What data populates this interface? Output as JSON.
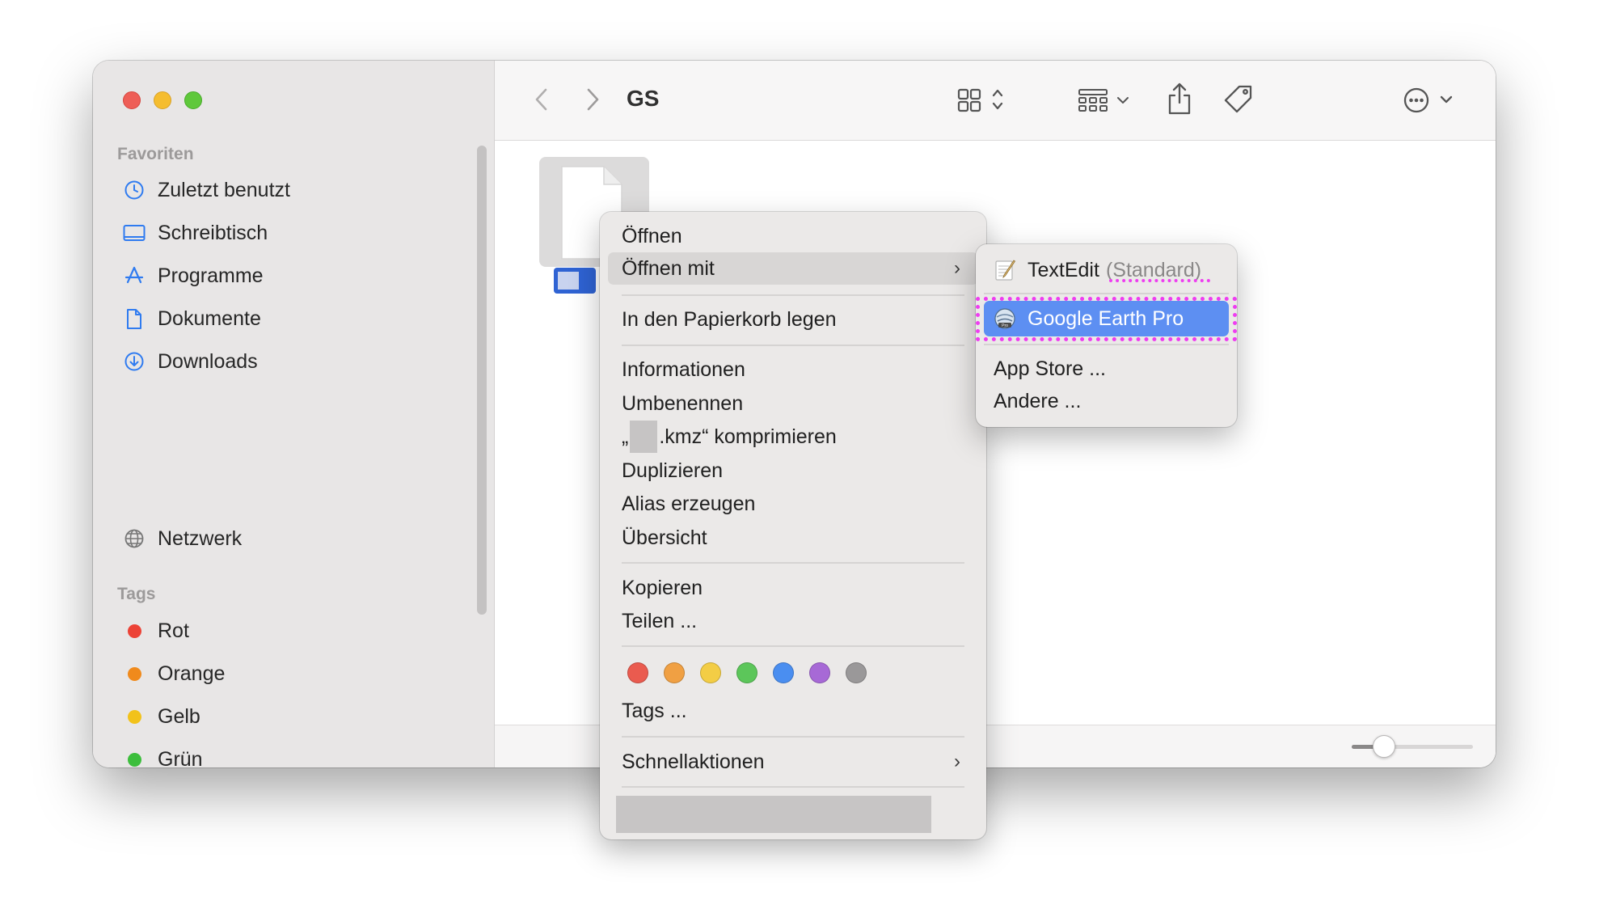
{
  "window": {
    "title": "GS"
  },
  "sidebar": {
    "favorites_heading": "Favoriten",
    "favorites": [
      {
        "label": "Zuletzt benutzt",
        "icon": "clock-icon"
      },
      {
        "label": "Schreibtisch",
        "icon": "desktop-icon"
      },
      {
        "label": "Programme",
        "icon": "apps-icon"
      },
      {
        "label": "Dokumente",
        "icon": "document-icon"
      },
      {
        "label": "Downloads",
        "icon": "download-icon"
      }
    ],
    "network": {
      "label": "Netzwerk",
      "icon": "globe-icon"
    },
    "tags_heading": "Tags",
    "tags": [
      {
        "label": "Rot",
        "color": "#ec4236"
      },
      {
        "label": "Orange",
        "color": "#f08a1c"
      },
      {
        "label": "Gelb",
        "color": "#f2c21a"
      },
      {
        "label": "Grün",
        "color": "#3cbe3c"
      }
    ]
  },
  "toolbar": {
    "icons": [
      "back-icon",
      "forward-icon",
      "grid-view-icon",
      "group-icon",
      "share-icon",
      "tag-icon",
      "more-icon",
      "search-icon"
    ]
  },
  "context_menu": {
    "items": {
      "open": "Öffnen",
      "open_with": "Öffnen mit",
      "trash": "In den Papierkorb legen",
      "info": "Informationen",
      "rename": "Umbenennen",
      "compress_prefix": "„",
      "compress_suffix": ".kmz“ komprimieren",
      "duplicate": "Duplizieren",
      "alias": "Alias erzeugen",
      "overview": "Übersicht",
      "copy": "Kopieren",
      "share": "Teilen ...",
      "tags": "Tags ...",
      "quick_actions": "Schnellaktionen"
    },
    "chevron": "›",
    "tag_colors": [
      "#ea5b4f",
      "#f0a043",
      "#f3cd45",
      "#5cc65a",
      "#4a8ef0",
      "#a769d6",
      "#9a9899"
    ]
  },
  "submenu": {
    "textedit": "TextEdit",
    "textedit_default": "(Standard)",
    "google_earth": "Google Earth Pro",
    "app_store": "App Store ...",
    "other": "Andere ...",
    "highlight_color": "#ee3df0",
    "selected_color": "#5d8ff2"
  }
}
